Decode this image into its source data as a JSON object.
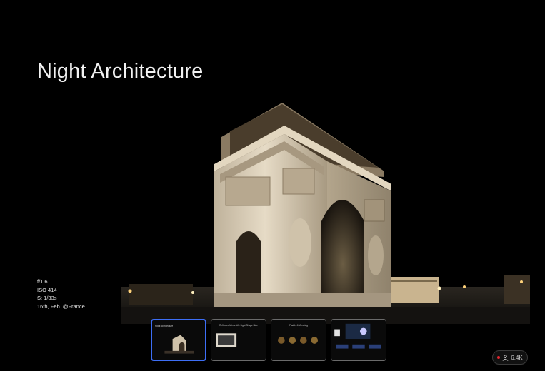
{
  "slide": {
    "title": "Night Architecture",
    "exif": {
      "aperture": "f/1.6",
      "iso": "ISO 414",
      "shutter": "S: 1/33s",
      "date_location": "16th, Feb. @France"
    }
  },
  "photo": {
    "icon": "arc-de-triomphe-night-photo"
  },
  "thumbnails": [
    {
      "label": "Night Architecture",
      "active": true
    },
    {
      "label": "Reflected Mirror Life Light Shape Side",
      "active": false
    },
    {
      "label": "Fast Left Mirroring",
      "active": false
    },
    {
      "label": "",
      "active": false
    }
  ],
  "likes": {
    "count": "6.4K",
    "icon": "person-icon",
    "dot_color": "#e0262f"
  },
  "colors": {
    "background": "#000000",
    "active_thumb": "#3d6ef5",
    "stone": "#d8cbb4"
  }
}
